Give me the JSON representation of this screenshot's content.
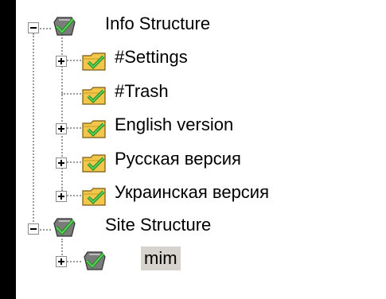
{
  "tree": {
    "nodes": [
      {
        "label": "Info Structure",
        "icon": "globe-check-icon",
        "expander": "expanded"
      },
      {
        "label": "#Settings",
        "icon": "folder-check-icon",
        "expander": "collapsed"
      },
      {
        "label": "#Trash",
        "icon": "folder-check-icon",
        "expander": "none"
      },
      {
        "label": "English version",
        "icon": "folder-check-icon",
        "expander": "collapsed"
      },
      {
        "label": "Русская версия",
        "icon": "folder-check-icon",
        "expander": "collapsed"
      },
      {
        "label": "Украинская версия",
        "icon": "folder-check-icon",
        "expander": "collapsed"
      },
      {
        "label": "Site Structure",
        "icon": "globe-check-icon",
        "expander": "expanded"
      },
      {
        "label": "mim",
        "icon": "globe-check-icon",
        "expander": "collapsed",
        "selected": true
      }
    ]
  },
  "colors": {
    "background": "#000000",
    "panel": "#ffffff",
    "selection": "#d6d3ce",
    "check": "#2ea82e",
    "folder": "#f2c64a"
  }
}
